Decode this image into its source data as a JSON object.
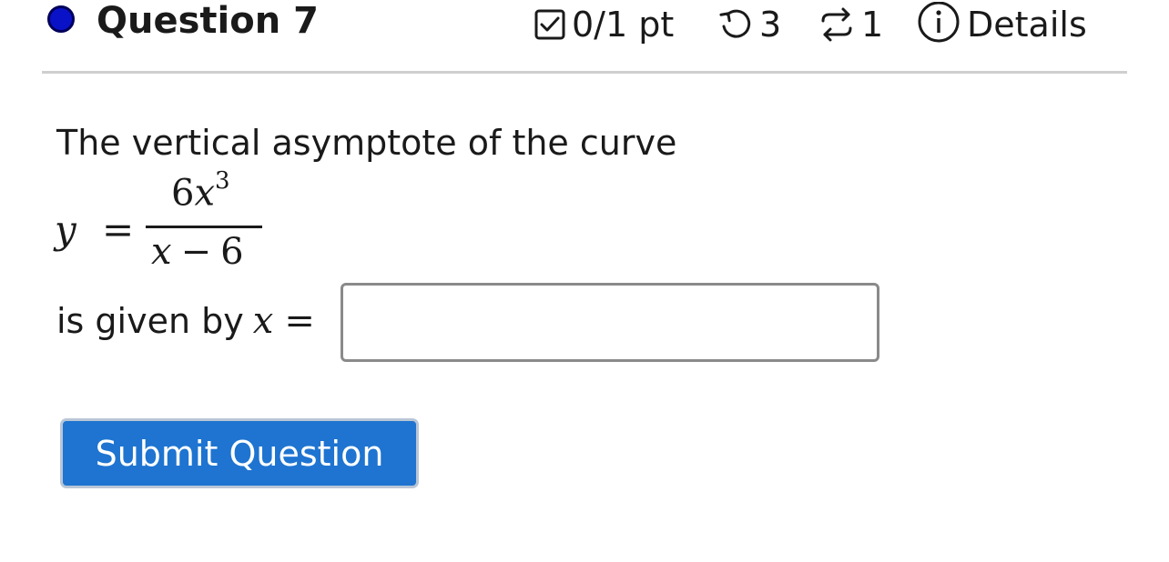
{
  "header": {
    "title": "Question 7",
    "points": "0/1 pt",
    "attempts": "3",
    "retries": "1",
    "details_label": "Details",
    "status_color": "#0a12c8"
  },
  "question": {
    "prompt": "The vertical asymptote of the curve",
    "equation": {
      "lhs": "y",
      "eq": "=",
      "numerator_coef": "6",
      "numerator_var": "x",
      "numerator_exp": "3",
      "denominator_var": "x",
      "denominator_op": "−",
      "denominator_const": "6"
    },
    "given_text": "is given by",
    "given_var": "x",
    "given_eq": "=",
    "answer_value": "",
    "answer_placeholder": ""
  },
  "actions": {
    "submit_label": "Submit Question",
    "submit_color": "#1e74d0"
  },
  "icons": {
    "status": "status-dot-icon",
    "points": "checkbox-icon",
    "attempts": "undo-icon",
    "retries": "retry-icon",
    "details": "info-icon"
  }
}
